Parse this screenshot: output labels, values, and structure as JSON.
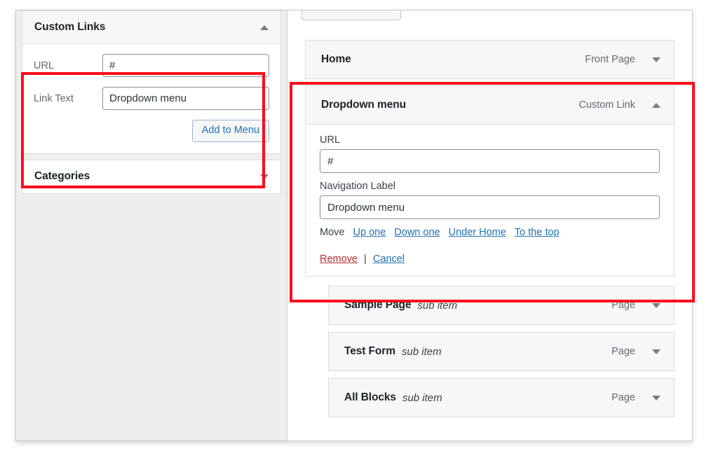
{
  "sidebar": {
    "panels": [
      {
        "title": "Custom Links",
        "caret": "caret-up-icon",
        "expanded": true,
        "fields": [
          {
            "label": "URL",
            "value": "#",
            "name": "url"
          },
          {
            "label": "Link Text",
            "value": "Dropdown menu",
            "name": "link-text"
          }
        ],
        "button": "Add to Menu"
      },
      {
        "title": "Categories",
        "caret": "caret-down-icon",
        "expanded": false
      }
    ]
  },
  "menu_structure": {
    "items": [
      {
        "title": "Home",
        "type": "Front Page",
        "caret": "caret-down-icon",
        "expanded": false,
        "sub_item": "",
        "depth": 0
      },
      {
        "title": "Dropdown menu",
        "type": "Custom Link",
        "caret": "caret-up-icon",
        "expanded": true,
        "sub_item": "",
        "depth": 0,
        "details": {
          "url_label": "URL",
          "url_value": "#",
          "nav_label_label": "Navigation Label",
          "nav_label_value": "Dropdown menu",
          "move_label": "Move",
          "move_links": [
            "Up one",
            "Down one",
            "Under Home",
            "To the top"
          ],
          "remove_label": "Remove",
          "separator": "|",
          "cancel_label": "Cancel"
        }
      },
      {
        "title": "Sample Page",
        "type": "Page",
        "caret": "caret-down-icon",
        "expanded": false,
        "sub_item": "sub item",
        "depth": 1
      },
      {
        "title": "Test Form",
        "type": "Page",
        "caret": "caret-down-icon",
        "expanded": false,
        "sub_item": "sub item",
        "depth": 1
      },
      {
        "title": "All Blocks",
        "type": "Page",
        "caret": "caret-down-icon",
        "expanded": false,
        "sub_item": "sub item",
        "depth": 1
      }
    ]
  },
  "annotations": {
    "highlight_color": "#fc0d1b",
    "boxes": [
      {
        "name": "custom-links-form-highlight"
      },
      {
        "name": "dropdown-menu-item-highlight"
      }
    ]
  },
  "colors": {
    "accent_link": "#2271b1",
    "danger_link": "#b32d2e",
    "panel_bg": "#f6f7f7",
    "page_bg": "#eeeeee"
  }
}
